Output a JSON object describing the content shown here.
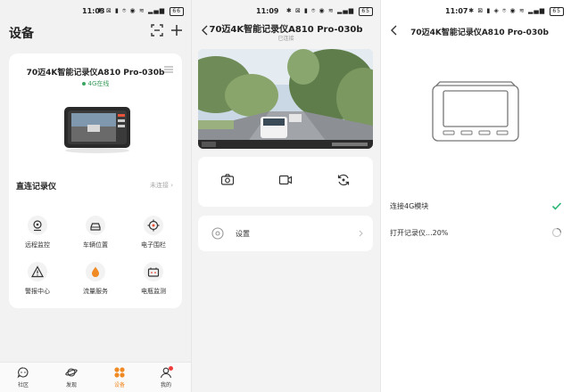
{
  "panel1": {
    "status": {
      "time": "11:03",
      "battery": "66"
    },
    "title": "设备",
    "device": {
      "name": "70迈4K智能记录仪A810 Pro-030b",
      "online": "4G在线"
    },
    "direct": {
      "label": "直连记录仪",
      "status": "未连接"
    },
    "features": [
      {
        "label": "远程监控",
        "icon": "remote-monitor-icon"
      },
      {
        "label": "车辆位置",
        "icon": "car-icon"
      },
      {
        "label": "电子围栏",
        "icon": "target-icon"
      },
      {
        "label": "警报中心",
        "icon": "warning-icon"
      },
      {
        "label": "流量服务",
        "icon": "drop-icon"
      },
      {
        "label": "电瓶监测",
        "icon": "battery-icon"
      }
    ],
    "tabs": [
      {
        "label": "社区",
        "icon": "community-icon"
      },
      {
        "label": "发现",
        "icon": "planet-icon"
      },
      {
        "label": "设备",
        "icon": "device-grid-icon"
      },
      {
        "label": "我的",
        "icon": "profile-icon"
      }
    ],
    "accent": "#f08a24"
  },
  "panel2": {
    "status": {
      "time": "11:09",
      "battery": "65"
    },
    "title": "70迈4K智能记录仪A810 Pro-030b",
    "subtitle": "已连接",
    "controls": [
      "camera-icon",
      "video-icon",
      "switch-camera-icon"
    ],
    "settings_label": "设置"
  },
  "panel3": {
    "status": {
      "time": "11:07",
      "battery": "65"
    },
    "title": "70迈4K智能记录仪A810 Pro-030b",
    "steps": [
      {
        "label": "连接4G模块",
        "state": "done"
      },
      {
        "label": "打开记录仪...20%",
        "state": "loading",
        "progress": 20
      }
    ],
    "done_color": "#2bb673"
  }
}
